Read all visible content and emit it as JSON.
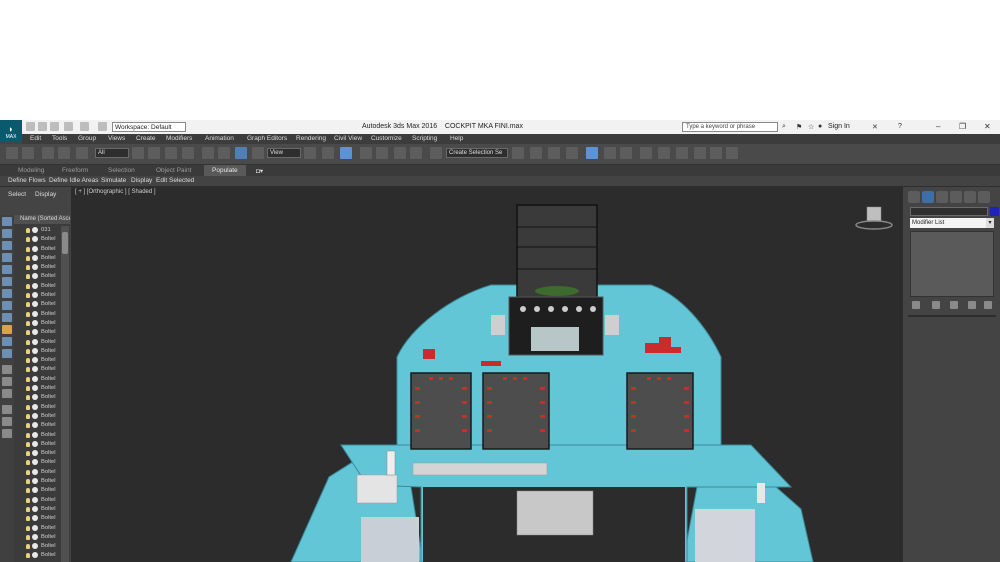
{
  "app": {
    "title": "Autodesk 3ds Max 2016",
    "file": "COCKPIT MKA FINI.max",
    "logo_label": "MAX",
    "workspace": "Workspace: Default",
    "search_placeholder": "Type a keyword or phrase",
    "sign_in": "Sign In"
  },
  "menu": [
    "Edit",
    "Tools",
    "Group",
    "Views",
    "Create",
    "Modifiers",
    "Animation",
    "Graph Editors",
    "Rendering",
    "Civil View",
    "Customize",
    "Scripting",
    "Help"
  ],
  "toolbar": {
    "filter": "All",
    "ref_coord": "View",
    "selection_set": "Create Selection Se"
  },
  "ribbon": {
    "tabs": [
      "Modeling",
      "Freeform",
      "Selection",
      "Object Paint",
      "Populate"
    ],
    "active_tab": "Populate",
    "commands": [
      "Define Flows",
      "Define Idle Areas",
      "Simulate",
      "Display",
      "Edit Selected"
    ]
  },
  "scene_explorer": {
    "tabs": [
      "Select",
      "Display"
    ],
    "header": "Name (Sorted Ascen",
    "items": [
      "031",
      "Boltel",
      "Boltel",
      "Boltel",
      "Boltel",
      "Boltel",
      "Boltel",
      "Boltel",
      "Boltel",
      "Boltel",
      "Boltel",
      "Boltel",
      "Boltel",
      "Boltel",
      "Boltel",
      "Boltel",
      "Boltel",
      "Boltel",
      "Boltel",
      "Boltel",
      "Boltel",
      "Boltel",
      "Boltel",
      "Boltel",
      "Boltel",
      "Boltel",
      "Boltel",
      "Boltel",
      "Boltel",
      "Boltel",
      "Boltel",
      "Boltel",
      "Boltel",
      "Boltel",
      "Boltel",
      "Boltel"
    ]
  },
  "viewport": {
    "label": "[ + ] [Orthographic ] [ Shaded ]"
  },
  "command_panel": {
    "modifier_list": "Modifier List"
  },
  "colors": {
    "cockpit_fill": "#63c6d6",
    "panel_dark": "#4d4d4d",
    "object_color": "#1f24b8",
    "accent_red": "#cc2b2b"
  }
}
